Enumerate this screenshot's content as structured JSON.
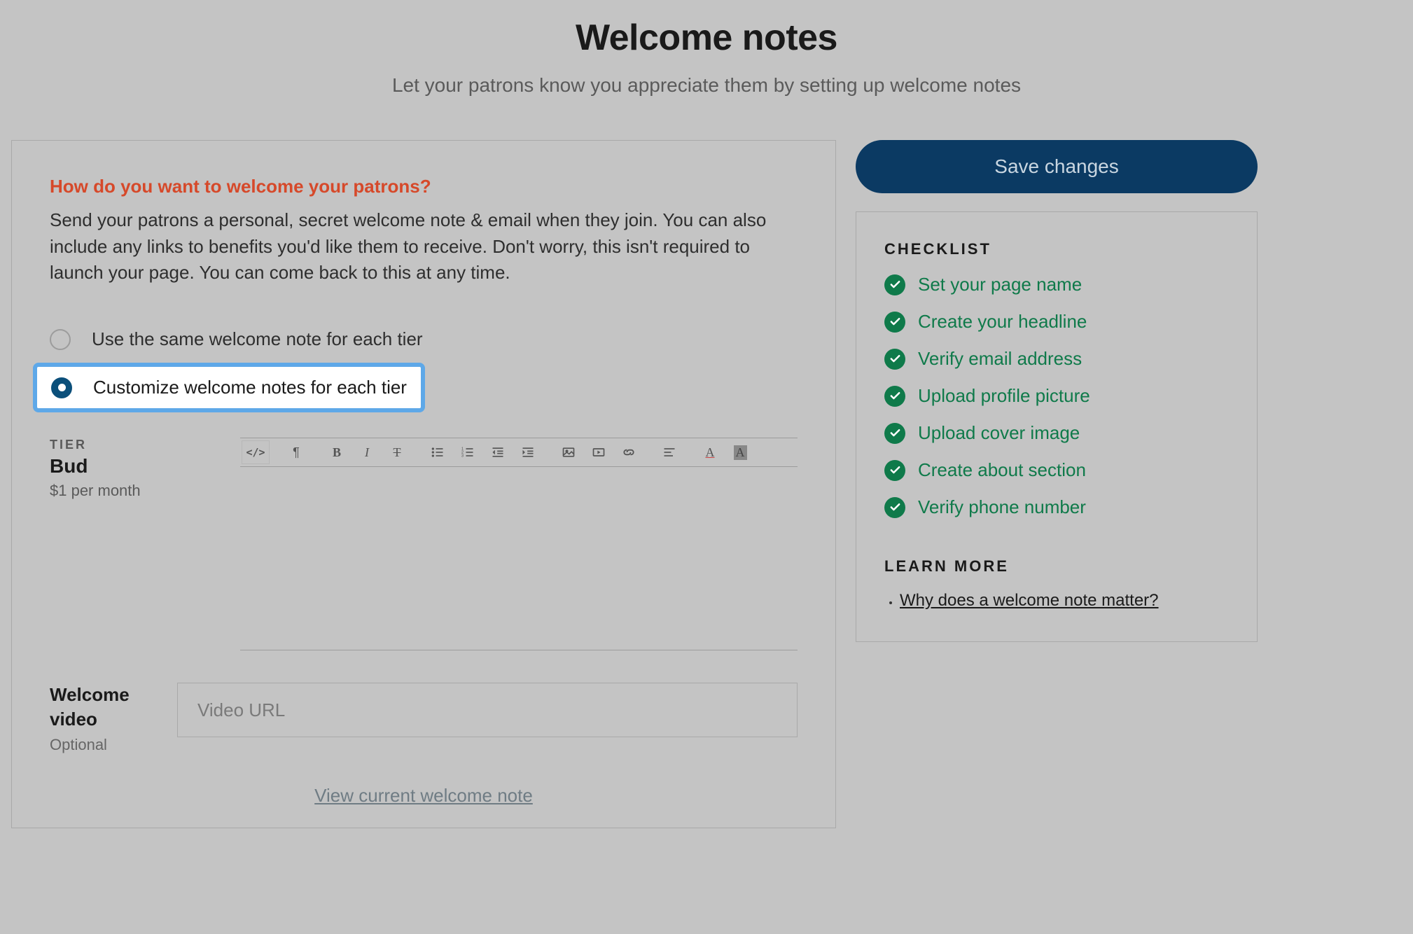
{
  "header": {
    "title": "Welcome notes",
    "subtitle": "Let your patrons know you appreciate them by setting up welcome notes"
  },
  "main": {
    "prompt_heading": "How do you want to welcome your patrons?",
    "prompt_body": "Send your patrons a personal, secret welcome note & email when they join. You can also include any links to benefits you'd like them to receive. Don't worry, this isn't required to launch your page. You can come back to this at any time.",
    "radios": {
      "same": "Use the same welcome note for each tier",
      "custom": "Customize welcome notes for each tier"
    },
    "tier": {
      "label": "TIER",
      "name": "Bud",
      "price": "$1 per month"
    },
    "video": {
      "label_line1": "Welcome",
      "label_line2": "video",
      "optional": "Optional",
      "placeholder": "Video URL",
      "value": ""
    },
    "view_link": "View current welcome note"
  },
  "sidebar": {
    "save_label": "Save changes",
    "checklist_heading": "CHECKLIST",
    "checklist": [
      "Set your page name",
      "Create your headline",
      "Verify email address",
      "Upload profile picture",
      "Upload cover image",
      "Create about section",
      "Verify phone number"
    ],
    "learn_more_heading": "LEARN MORE",
    "learn_more_link": "Why does a welcome note matter?"
  }
}
